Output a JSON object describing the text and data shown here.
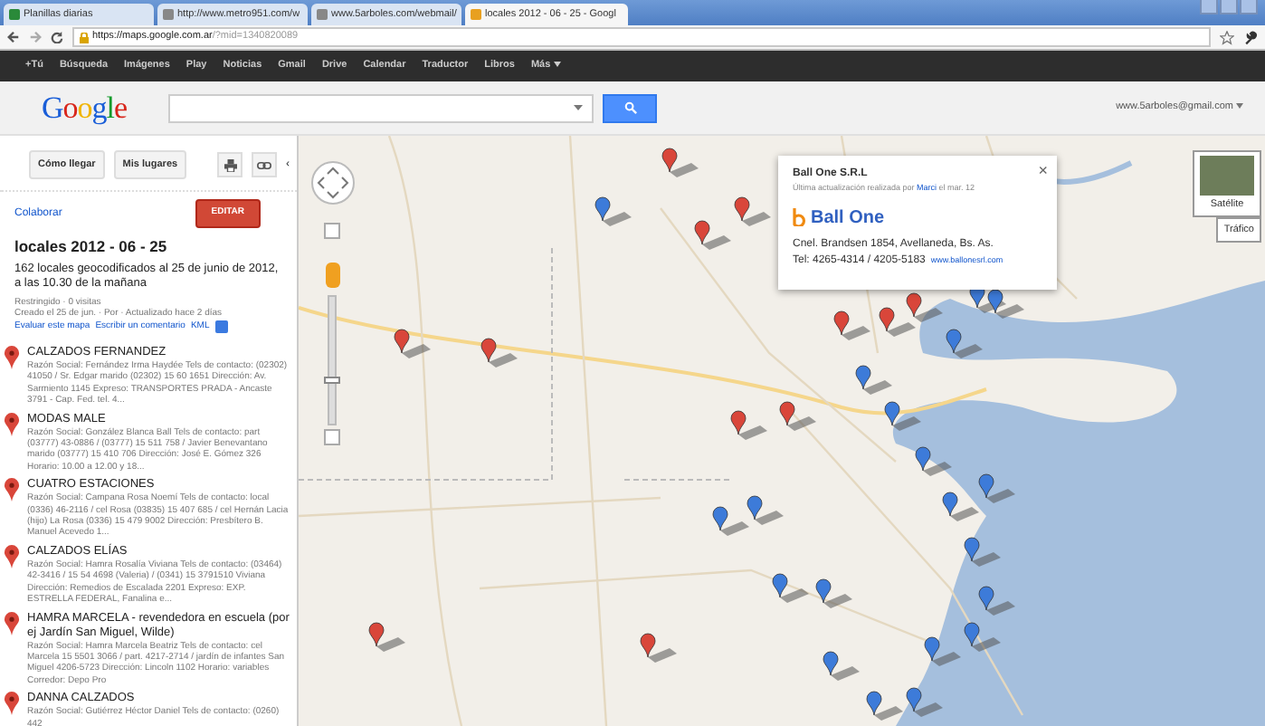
{
  "browser": {
    "tabs": [
      {
        "label": "Planillas diarias",
        "selected": false
      },
      {
        "label": "http://www.metro951.com/w",
        "selected": false
      },
      {
        "label": "www.5arboles.com/webmail/",
        "selected": false
      },
      {
        "label": "locales 2012 - 06 - 25 - Googl",
        "selected": true
      }
    ],
    "url_host": "https://maps.google.com.ar",
    "url_rest": "/?mid=1340820089"
  },
  "google_bar": {
    "items": [
      "+Tú",
      "Búsqueda",
      "Imágenes",
      "Play",
      "Noticias",
      "Gmail",
      "Drive",
      "Calendar",
      "Traductor",
      "Libros",
      "Más"
    ]
  },
  "header": {
    "logo": "Google",
    "account": "www.5arboles@gmail.com"
  },
  "sidebar": {
    "buttons": [
      "Cómo llegar",
      "Mis lugares"
    ],
    "collapse": "‹",
    "collaborate": "Colaborar",
    "edit": "EDITAR",
    "title": "locales 2012 - 06 - 25",
    "description": "162 locales geocodificados al 25 de junio de 2012, a las 10.30 de la mañana",
    "meta": [
      "Restringido · 0 visitas",
      "Creado el 25 de jun. · Por · Actualizado hace 2 días"
    ],
    "links": [
      "Evaluar este mapa",
      "Escribir un comentario",
      "KML"
    ],
    "places": [
      {
        "name": "CALZADOS FERNANDEZ",
        "snippet": "Razón Social: Fernández Irma Haydée Tels de contacto: (02302) 41050 / Sr. Edgar marido (02302) 15 60 1651 Dirección: Av. Sarmiento 1145 Expreso: TRANSPORTES PRADA - Ancaste 3791 - Cap. Fed. tel. 4..."
      },
      {
        "name": "MODAS MALE",
        "snippet": "Razón Social: González Blanca Ball Tels de contacto: part (03777) 43-0886 / (03777) 15 511 758 / Javier Benevantano marido (03777) 15 410 706 Dirección: José E. Gómez 326 Horario: 10.00 a 12.00 y 18..."
      },
      {
        "name": "CUATRO ESTACIONES",
        "snippet": "Razón Social: Campana Rosa Noemí Tels de contacto: local (0336) 46-2116 / cel Rosa (03835) 15 407 685 / cel Hernán Lacia (hijo) La Rosa (0336) 15 479 9002 Dirección: Presbítero B. Manuel Acevedo 1..."
      },
      {
        "name": "CALZADOS ELÍAS",
        "snippet": "Razón Social: Hamra Rosalía Viviana Tels de contacto: (03464) 42-3416 / 15 54 4698 (Valeria) / (0341) 15 3791510 Viviana Dirección: Remedios de Escalada 2201 Expreso: EXP. ESTRELLA FEDERAL, Fanalina e..."
      },
      {
        "name": "HAMRA MARCELA - revendedora en escuela (por ej Jardín San Miguel, Wilde)",
        "snippet": "Razón Social: Hamra Marcela Beatriz Tels de contacto: cel Marcela 15 5501 3066 / part. 4217-2714 / jardín de infantes San Miguel 4206-5723 Dirección: Lincoln 1102 Horario: variables Corredor: Depo Pro"
      },
      {
        "name": "DANNA CALZADOS",
        "snippet": "Razón Social: Gutiérrez Héctor Daniel Tels de contacto: (0260) 442"
      }
    ]
  },
  "map": {
    "zoom_slider": {
      "level": 0.35
    },
    "info_window": {
      "title": "Ball One S.R.L",
      "updated_before": "Última actualización realizada por",
      "updated_by": "Marci",
      "updated_after": "el mar. 12",
      "logo": "Ball One",
      "address": "Cnel. Brandsen 1854, Avellaneda, Bs. As.",
      "phone": "Tel: 4265-4314 / 4205-5183",
      "website": "www.ballonesrl.com",
      "close": "×"
    },
    "map_types": [
      "Satélite",
      "Tráfico"
    ]
  }
}
